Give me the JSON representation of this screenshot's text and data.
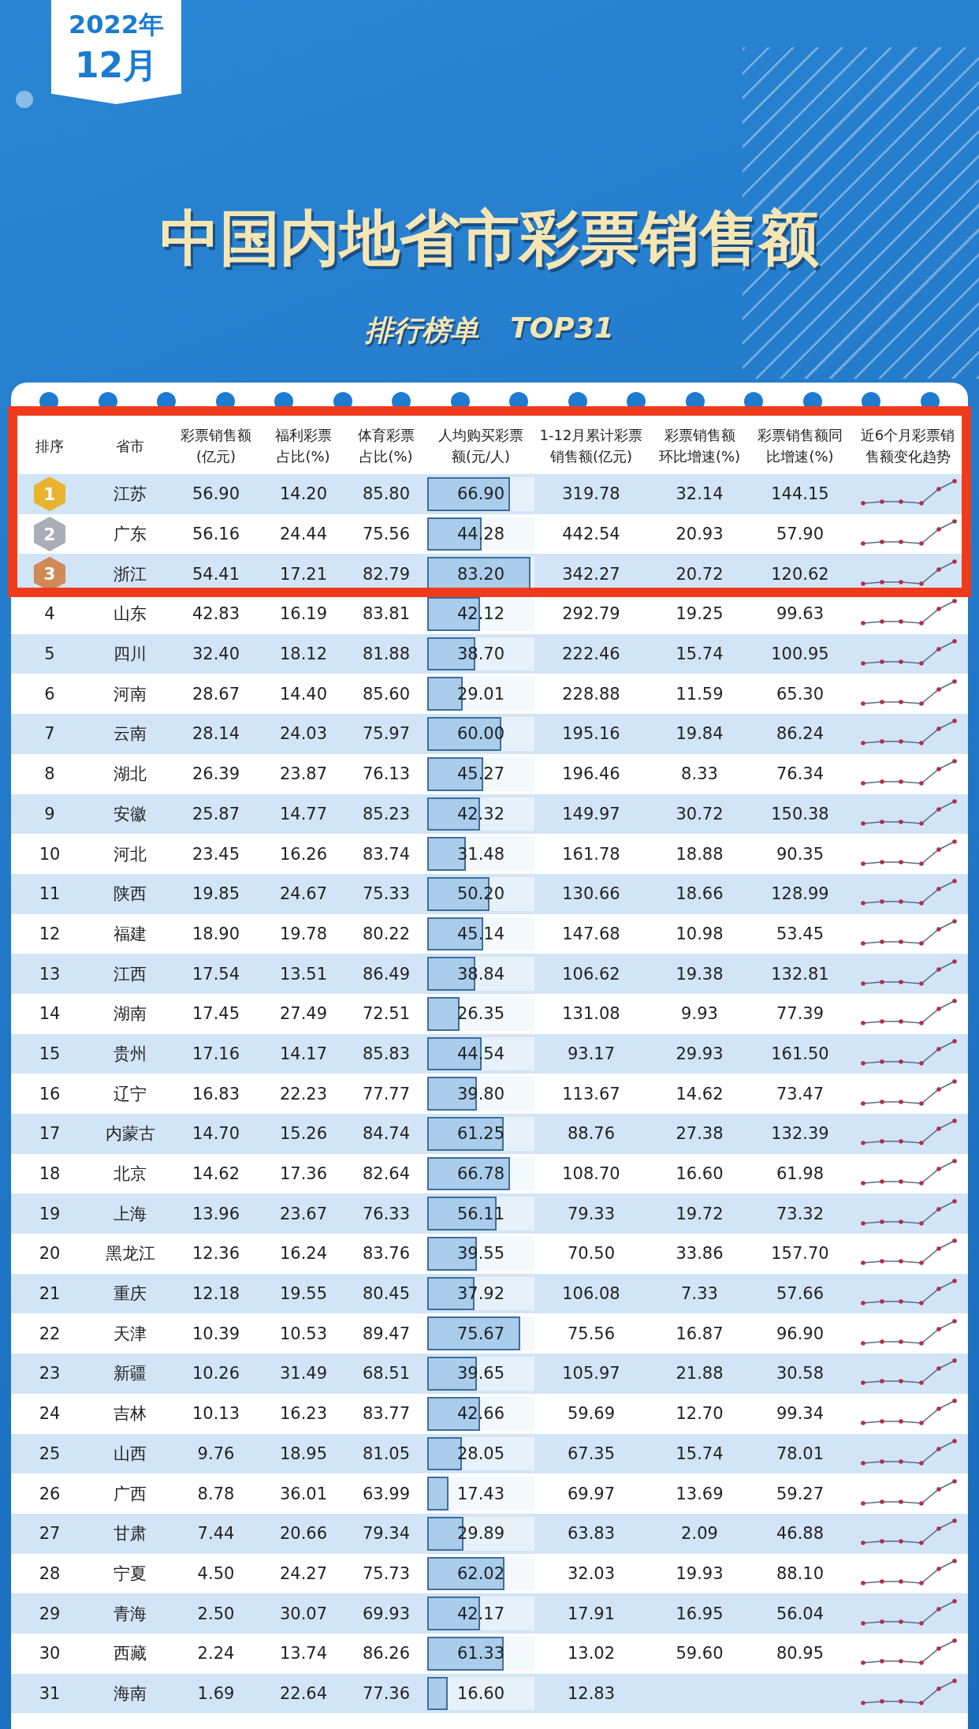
{
  "date_tag": {
    "year": "2022年",
    "month": "12月"
  },
  "title": "中国内地省市彩票销售额",
  "subtitle": {
    "label": "排行榜单",
    "tag": "TOP31"
  },
  "table": {
    "columns": [
      "排序",
      "省市",
      "彩票销售额(亿元)",
      "福利彩票占比(%)",
      "体育彩票占比(%)",
      "人均购买彩票额(元/人)",
      "1-12月累计彩票销售额(亿元)",
      "彩票销售额环比增速(%)",
      "彩票销售额同比增速(%)",
      "近6个月彩票销售额变化趋势"
    ],
    "rows": [
      {
        "kind": "medal",
        "color": "#e9b330",
        "rank": "1",
        "province": "江苏",
        "sales": "56.90",
        "welfare": "14.20",
        "sports": "85.80",
        "per_capita": "66.90",
        "level": 0.77,
        "cumulative": "319.78",
        "mom": "32.14",
        "yoy": "144.15",
        "highlighted": true
      },
      {
        "kind": "medal",
        "color": "#a9aeb6",
        "rank": "2",
        "province": "广东",
        "sales": "56.16",
        "welfare": "24.44",
        "sports": "75.56",
        "per_capita": "44.28",
        "level": 0.51,
        "cumulative": "442.54",
        "mom": "20.93",
        "yoy": "57.90",
        "highlighted": true
      },
      {
        "kind": "medal",
        "color": "#d08a55",
        "rank": "3",
        "province": "浙江",
        "sales": "54.41",
        "welfare": "17.21",
        "sports": "82.79",
        "per_capita": "83.20",
        "level": 0.96,
        "cumulative": "342.27",
        "mom": "20.72",
        "yoy": "120.62",
        "highlighted": true
      },
      {
        "kind": "number",
        "rank": "4",
        "province": "山东",
        "sales": "42.83",
        "welfare": "16.19",
        "sports": "83.81",
        "per_capita": "42.12",
        "level": 0.49,
        "cumulative": "292.79",
        "mom": "19.25",
        "yoy": "99.63",
        "highlighted": false
      },
      {
        "kind": "number",
        "rank": "5",
        "province": "四川",
        "sales": "32.40",
        "welfare": "18.12",
        "sports": "81.88",
        "per_capita": "38.70",
        "level": 0.45,
        "cumulative": "222.46",
        "mom": "15.74",
        "yoy": "100.95",
        "highlighted": false
      },
      {
        "kind": "number",
        "rank": "6",
        "province": "河南",
        "sales": "28.67",
        "welfare": "14.40",
        "sports": "85.60",
        "per_capita": "29.01",
        "level": 0.33,
        "cumulative": "228.88",
        "mom": "11.59",
        "yoy": "65.30",
        "highlighted": false
      },
      {
        "kind": "number",
        "rank": "7",
        "province": "云南",
        "sales": "28.14",
        "welfare": "24.03",
        "sports": "75.97",
        "per_capita": "60.00",
        "level": 0.69,
        "cumulative": "195.16",
        "mom": "19.84",
        "yoy": "86.24",
        "highlighted": false
      },
      {
        "kind": "number",
        "rank": "8",
        "province": "湖北",
        "sales": "26.39",
        "welfare": "23.87",
        "sports": "76.13",
        "per_capita": "45.27",
        "level": 0.52,
        "cumulative": "196.46",
        "mom": "8.33",
        "yoy": "76.34",
        "highlighted": false
      },
      {
        "kind": "number",
        "rank": "9",
        "province": "安徽",
        "sales": "25.87",
        "welfare": "14.77",
        "sports": "85.23",
        "per_capita": "42.32",
        "level": 0.49,
        "cumulative": "149.97",
        "mom": "30.72",
        "yoy": "150.38",
        "highlighted": false
      },
      {
        "kind": "number",
        "rank": "10",
        "province": "河北",
        "sales": "23.45",
        "welfare": "16.26",
        "sports": "83.74",
        "per_capita": "31.48",
        "level": 0.36,
        "cumulative": "161.78",
        "mom": "18.88",
        "yoy": "90.35",
        "highlighted": false
      },
      {
        "kind": "number",
        "rank": "11",
        "province": "陕西",
        "sales": "19.85",
        "welfare": "24.67",
        "sports": "75.33",
        "per_capita": "50.20",
        "level": 0.58,
        "cumulative": "130.66",
        "mom": "18.66",
        "yoy": "128.99",
        "highlighted": false
      },
      {
        "kind": "number",
        "rank": "12",
        "province": "福建",
        "sales": "18.90",
        "welfare": "19.78",
        "sports": "80.22",
        "per_capita": "45.14",
        "level": 0.52,
        "cumulative": "147.68",
        "mom": "10.98",
        "yoy": "53.45",
        "highlighted": false
      },
      {
        "kind": "number",
        "rank": "13",
        "province": "江西",
        "sales": "17.54",
        "welfare": "13.51",
        "sports": "86.49",
        "per_capita": "38.84",
        "level": 0.45,
        "cumulative": "106.62",
        "mom": "19.38",
        "yoy": "132.81",
        "highlighted": false
      },
      {
        "kind": "number",
        "rank": "14",
        "province": "湖南",
        "sales": "17.45",
        "welfare": "27.49",
        "sports": "72.51",
        "per_capita": "26.35",
        "level": 0.3,
        "cumulative": "131.08",
        "mom": "9.93",
        "yoy": "77.39",
        "highlighted": false
      },
      {
        "kind": "number",
        "rank": "15",
        "province": "贵州",
        "sales": "17.16",
        "welfare": "14.17",
        "sports": "85.83",
        "per_capita": "44.54",
        "level": 0.51,
        "cumulative": "93.17",
        "mom": "29.93",
        "yoy": "161.50",
        "highlighted": false
      },
      {
        "kind": "number",
        "rank": "16",
        "province": "辽宁",
        "sales": "16.83",
        "welfare": "22.23",
        "sports": "77.77",
        "per_capita": "39.80",
        "level": 0.46,
        "cumulative": "113.67",
        "mom": "14.62",
        "yoy": "73.47",
        "highlighted": false
      },
      {
        "kind": "number",
        "rank": "17",
        "province": "内蒙古",
        "sales": "14.70",
        "welfare": "15.26",
        "sports": "84.74",
        "per_capita": "61.25",
        "level": 0.71,
        "cumulative": "88.76",
        "mom": "27.38",
        "yoy": "132.39",
        "highlighted": false
      },
      {
        "kind": "number",
        "rank": "18",
        "province": "北京",
        "sales": "14.62",
        "welfare": "17.36",
        "sports": "82.64",
        "per_capita": "66.78",
        "level": 0.77,
        "cumulative": "108.70",
        "mom": "16.60",
        "yoy": "61.98",
        "highlighted": false
      },
      {
        "kind": "number",
        "rank": "19",
        "province": "上海",
        "sales": "13.96",
        "welfare": "23.67",
        "sports": "76.33",
        "per_capita": "56.11",
        "level": 0.65,
        "cumulative": "79.33",
        "mom": "19.72",
        "yoy": "73.32",
        "highlighted": false
      },
      {
        "kind": "number",
        "rank": "20",
        "province": "黑龙江",
        "sales": "12.36",
        "welfare": "16.24",
        "sports": "83.76",
        "per_capita": "39.55",
        "level": 0.46,
        "cumulative": "70.50",
        "mom": "33.86",
        "yoy": "157.70",
        "highlighted": false
      },
      {
        "kind": "number",
        "rank": "21",
        "province": "重庆",
        "sales": "12.18",
        "welfare": "19.55",
        "sports": "80.45",
        "per_capita": "37.92",
        "level": 0.44,
        "cumulative": "106.08",
        "mom": "7.33",
        "yoy": "57.66",
        "highlighted": false
      },
      {
        "kind": "number",
        "rank": "22",
        "province": "天津",
        "sales": "10.39",
        "welfare": "10.53",
        "sports": "89.47",
        "per_capita": "75.67",
        "level": 0.87,
        "cumulative": "75.56",
        "mom": "16.87",
        "yoy": "96.90",
        "highlighted": false
      },
      {
        "kind": "number",
        "rank": "23",
        "province": "新疆",
        "sales": "10.26",
        "welfare": "31.49",
        "sports": "68.51",
        "per_capita": "39.65",
        "level": 0.46,
        "cumulative": "105.97",
        "mom": "21.88",
        "yoy": "30.58",
        "highlighted": false
      },
      {
        "kind": "number",
        "rank": "24",
        "province": "吉林",
        "sales": "10.13",
        "welfare": "16.23",
        "sports": "83.77",
        "per_capita": "42.66",
        "level": 0.49,
        "cumulative": "59.69",
        "mom": "12.70",
        "yoy": "99.34",
        "highlighted": false
      },
      {
        "kind": "number",
        "rank": "25",
        "province": "山西",
        "sales": "9.76",
        "welfare": "18.95",
        "sports": "81.05",
        "per_capita": "28.05",
        "level": 0.32,
        "cumulative": "67.35",
        "mom": "15.74",
        "yoy": "78.01",
        "highlighted": false
      },
      {
        "kind": "number",
        "rank": "26",
        "province": "广西",
        "sales": "8.78",
        "welfare": "36.01",
        "sports": "63.99",
        "per_capita": "17.43",
        "level": 0.2,
        "cumulative": "69.97",
        "mom": "13.69",
        "yoy": "59.27",
        "highlighted": false
      },
      {
        "kind": "number",
        "rank": "27",
        "province": "甘肃",
        "sales": "7.44",
        "welfare": "20.66",
        "sports": "79.34",
        "per_capita": "29.89",
        "level": 0.34,
        "cumulative": "63.83",
        "mom": "2.09",
        "yoy": "46.88",
        "highlighted": false
      },
      {
        "kind": "number",
        "rank": "28",
        "province": "宁夏",
        "sales": "4.50",
        "welfare": "24.27",
        "sports": "75.73",
        "per_capita": "62.02",
        "level": 0.72,
        "cumulative": "32.03",
        "mom": "19.93",
        "yoy": "88.10",
        "highlighted": false
      },
      {
        "kind": "number",
        "rank": "29",
        "province": "青海",
        "sales": "2.50",
        "welfare": "30.07",
        "sports": "69.93",
        "per_capita": "42.17",
        "level": 0.49,
        "cumulative": "17.91",
        "mom": "16.95",
        "yoy": "56.04",
        "highlighted": false
      },
      {
        "kind": "number",
        "rank": "30",
        "province": "西藏",
        "sales": "2.24",
        "welfare": "13.74",
        "sports": "86.26",
        "per_capita": "61.33",
        "level": 0.71,
        "cumulative": "13.02",
        "mom": "59.60",
        "yoy": "80.95",
        "highlighted": false
      },
      {
        "kind": "number",
        "rank": "31",
        "province": "海南",
        "sales": "1.69",
        "welfare": "22.64",
        "sports": "77.36",
        "per_capita": "16.60",
        "level": 0.19,
        "cumulative": "12.83",
        "highlighted": false
      }
    ]
  }
}
